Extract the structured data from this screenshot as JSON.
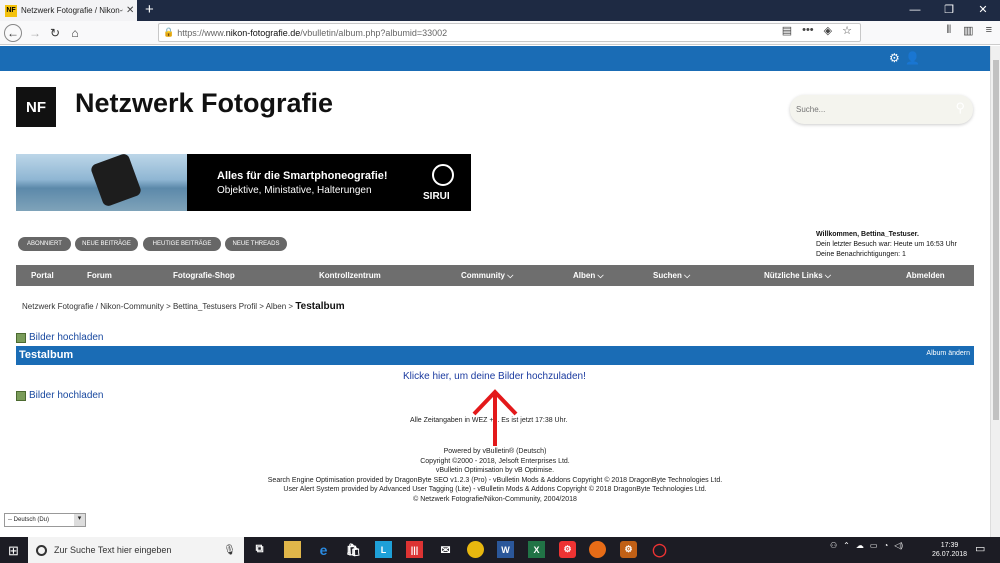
{
  "browser": {
    "tab_title": "Netzwerk Fotografie / Nikon-C",
    "favicon_text": "NF",
    "url_prefix": "https://www.",
    "url_domain": "nikon-fotografie.de",
    "url_path": "/vbulletin/album.php?albumid=33002"
  },
  "site": {
    "title": "Netzwerk Fotografie",
    "logo_text": "NF",
    "search_placeholder": "Suche...",
    "banner": {
      "headline": "Alles für die Smartphoneografie!",
      "subline": "Objektive, Ministative, Halterungen",
      "brand": "SIRUI"
    },
    "quick_links": [
      "ABONNIERT",
      "NEUE BEITRÄGE",
      "HEUTIGE BEITRÄGE",
      "NEUE THREADS"
    ],
    "welcome": {
      "greeting": "Willkommen, Bettina_Testuser.",
      "last_visit": "Dein letzter Besuch war: Heute um 16:53 Uhr",
      "notifications": "Deine Benachrichtigungen: 1"
    },
    "main_nav": [
      "Portal",
      "Forum",
      "Fotografie-Shop",
      "Kontrollzentrum",
      "Community",
      "Alben",
      "Suchen",
      "Nützliche Links",
      "Abmelden"
    ],
    "breadcrumb": {
      "root": "Netzwerk Fotografie / Nikon-Community",
      "profile": "Bettina_Testusers Profil",
      "albums": "Alben",
      "current": "Testalbum",
      "sep": ">"
    },
    "upload_link": "Bilder hochladen",
    "album": {
      "title": "Testalbum",
      "edit_label": "Album ändern",
      "upload_hint": "Klicke hier, um deine Bilder hochzuladen!"
    },
    "timezone_note": "Alle Zeitangaben in WEZ +2. Es ist jetzt 17:38 Uhr.",
    "footer_lines": [
      "Powered by vBulletin® (Deutsch)",
      "Copyright ©2000 - 2018, Jelsoft Enterprises Ltd.",
      "vBulletin Optimisation by vB Optimise.",
      "Search Engine Optimisation provided by DragonByte SEO v1.2.3 (Pro) - vBulletin Mods & Addons Copyright © 2018 DragonByte Technologies Ltd.",
      "User Alert System provided by Advanced User Tagging (Lite) - vBulletin Mods & Addons Copyright © 2018 DragonByte Technologies Ltd.",
      "© Netzwerk Fotografie/Nikon-Community, 2004/2018"
    ],
    "language_select": "-- Deutsch (Du)"
  },
  "taskbar": {
    "search_placeholder": "Zur Suche Text hier eingeben",
    "time": "17:39",
    "date": "26.07.2018"
  },
  "colors": {
    "brand_blue": "#1a6cb5",
    "nav_gray": "#6e6e6e"
  }
}
